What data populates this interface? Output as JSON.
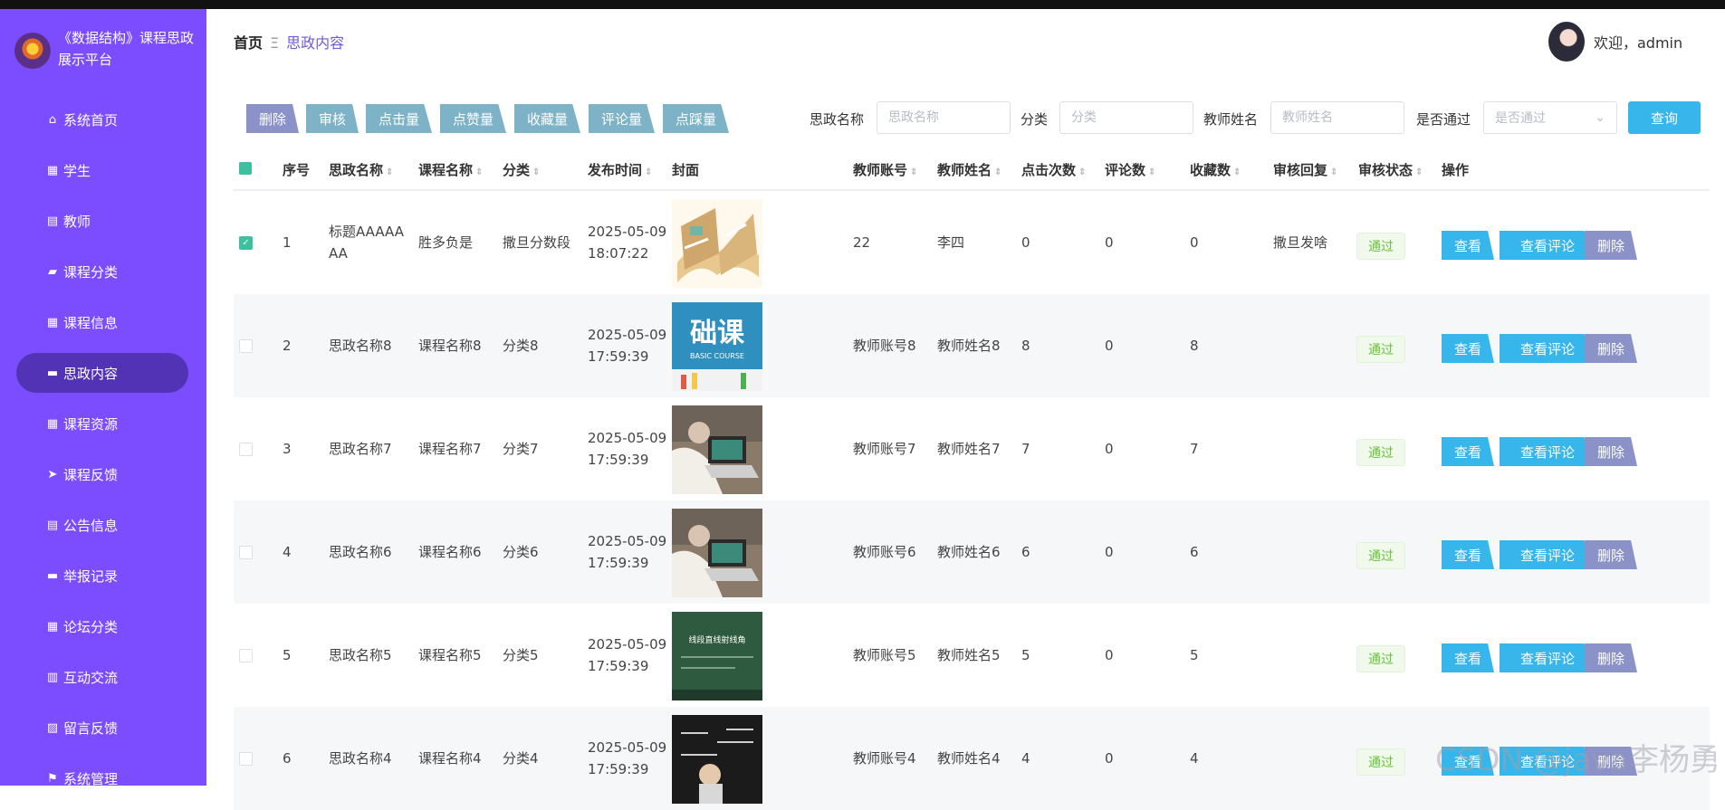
{
  "sidebar": {
    "title": "《数据结构》课程思政展示平台",
    "items": [
      {
        "label": "系统首页",
        "icon": "home-icon",
        "glyph": "⌂"
      },
      {
        "label": "学生",
        "icon": "grid-icon",
        "glyph": "▦"
      },
      {
        "label": "教师",
        "icon": "document-icon",
        "glyph": "▤"
      },
      {
        "label": "课程分类",
        "icon": "folder-icon",
        "glyph": "▰"
      },
      {
        "label": "课程信息",
        "icon": "grid-icon",
        "glyph": "▦"
      },
      {
        "label": "思政内容",
        "icon": "chat-icon",
        "glyph": "▬",
        "active": true
      },
      {
        "label": "课程资源",
        "icon": "grid-icon",
        "glyph": "▦"
      },
      {
        "label": "课程反馈",
        "icon": "send-icon",
        "glyph": "➤"
      },
      {
        "label": "公告信息",
        "icon": "clipboard-icon",
        "glyph": "▤"
      },
      {
        "label": "举报记录",
        "icon": "monitor-icon",
        "glyph": "▬"
      },
      {
        "label": "论坛分类",
        "icon": "grid-icon",
        "glyph": "▦"
      },
      {
        "label": "互动交流",
        "icon": "book-icon",
        "glyph": "▥"
      },
      {
        "label": "留言反馈",
        "icon": "chart-icon",
        "glyph": "▨"
      },
      {
        "label": "系统管理",
        "icon": "flag-icon",
        "glyph": "⚑"
      }
    ]
  },
  "header": {
    "breadcrumb_home": "首页",
    "breadcrumb_sep": "Ξ",
    "breadcrumb_current": "思政内容",
    "welcome": "欢迎，admin"
  },
  "toolbar": {
    "buttons": [
      "删除",
      "审核",
      "点击量",
      "点赞量",
      "收藏量",
      "评论量",
      "点踩量"
    ],
    "filters": [
      {
        "label": "思政名称",
        "placeholder": "思政名称"
      },
      {
        "label": "分类",
        "placeholder": "分类"
      },
      {
        "label": "教师姓名",
        "placeholder": "教师姓名"
      }
    ],
    "pass_label": "是否通过",
    "pass_placeholder": "是否通过",
    "query": "查询"
  },
  "table": {
    "columns": [
      "序号",
      "思政名称",
      "课程名称",
      "分类",
      "发布时间",
      "封面",
      "教师账号",
      "教师姓名",
      "点击次数",
      "评论数",
      "收藏数",
      "审核回复",
      "审核状态",
      "操作"
    ],
    "rows": [
      {
        "checked": true,
        "no": "1",
        "name": "标题AAAAAAA",
        "course": "胜多负是",
        "category": "撒旦分数段",
        "time": "2025-05-09 18:07:22",
        "cover": "book",
        "account": "22",
        "teacher": "李四",
        "clicks": "0",
        "comments": "0",
        "favs": "0",
        "reply": "撒旦发啥",
        "status": "通过"
      },
      {
        "checked": false,
        "no": "2",
        "name": "思政名称8",
        "course": "课程名称8",
        "category": "分类8",
        "time": "2025-05-09 17:59:39",
        "cover": "basic",
        "cover_text": "础课",
        "cover_sub": "BASIC COURSE",
        "account": "教师账号8",
        "teacher": "教师姓名8",
        "clicks": "8",
        "comments": "0",
        "favs": "8",
        "reply": "",
        "status": "通过"
      },
      {
        "checked": false,
        "no": "3",
        "name": "思政名称7",
        "course": "课程名称7",
        "category": "分类7",
        "time": "2025-05-09 17:59:39",
        "cover": "laptop",
        "account": "教师账号7",
        "teacher": "教师姓名7",
        "clicks": "7",
        "comments": "0",
        "favs": "7",
        "reply": "",
        "status": "通过"
      },
      {
        "checked": false,
        "no": "4",
        "name": "思政名称6",
        "course": "课程名称6",
        "category": "分类6",
        "time": "2025-05-09 17:59:39",
        "cover": "laptop",
        "account": "教师账号6",
        "teacher": "教师姓名6",
        "clicks": "6",
        "comments": "0",
        "favs": "6",
        "reply": "",
        "status": "通过"
      },
      {
        "checked": false,
        "no": "5",
        "name": "思政名称5",
        "course": "课程名称5",
        "category": "分类5",
        "time": "2025-05-09 17:59:39",
        "cover": "board",
        "cover_text": "线段直线射线角",
        "account": "教师账号5",
        "teacher": "教师姓名5",
        "clicks": "5",
        "comments": "0",
        "favs": "5",
        "reply": "",
        "status": "通过"
      },
      {
        "checked": false,
        "no": "6",
        "name": "思政名称4",
        "course": "课程名称4",
        "category": "分类4",
        "time": "2025-05-09 17:59:39",
        "cover": "chalk",
        "account": "教师账号4",
        "teacher": "教师姓名4",
        "clicks": "4",
        "comments": "0",
        "favs": "4",
        "reply": "",
        "status": "通过"
      }
    ],
    "ops": {
      "view": "查看",
      "comment": "查看评论",
      "delete": "删除"
    }
  },
  "watermark": "CSDN @java李杨勇",
  "colors": {
    "sidebar": "#7c4dff",
    "active": "#5233b6",
    "primary": "#36b6ea",
    "danger": "#8a92c8",
    "success": "#67c23a"
  }
}
